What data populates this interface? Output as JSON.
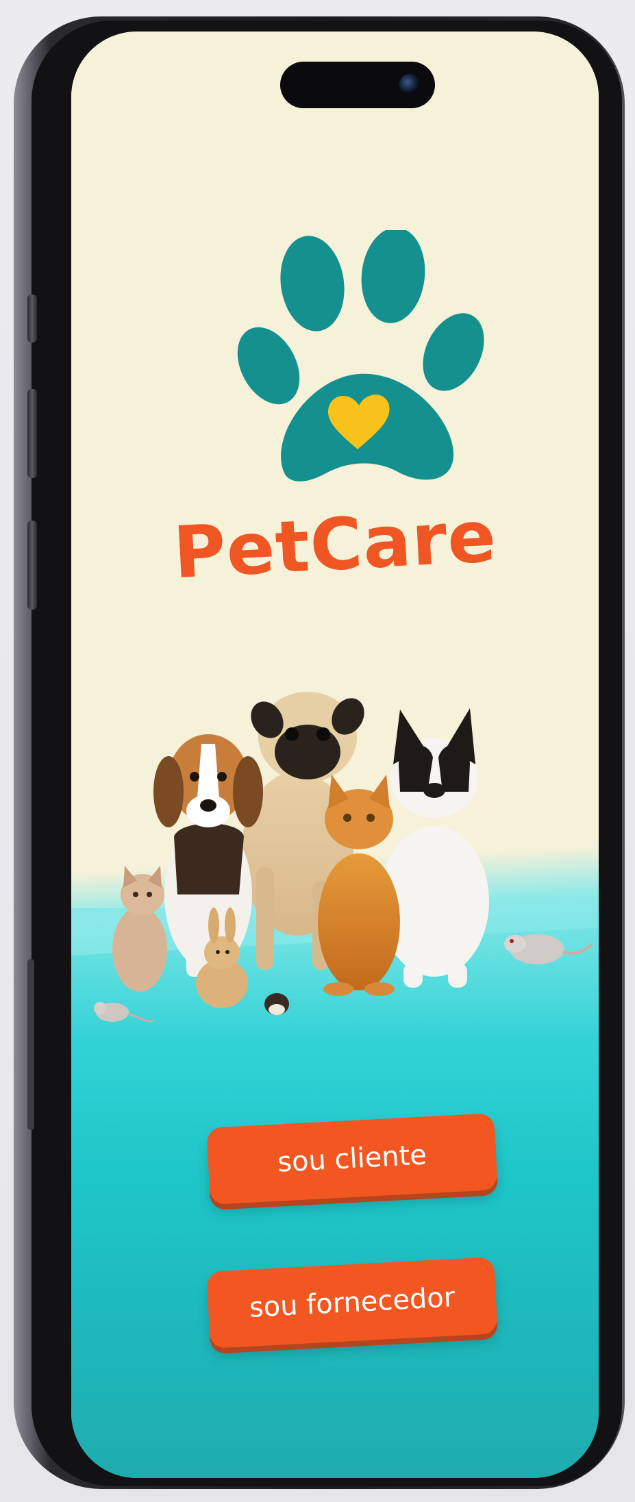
{
  "app": {
    "brand_name": "PetCare"
  },
  "actions": {
    "client_label": "sou cliente",
    "supplier_label": "sou fornecedor"
  },
  "colors": {
    "screen_background": "#f6f1d9",
    "floor_teal": "#1ec5c8",
    "paw_teal": "#14908f",
    "heart_yellow": "#f7c21a",
    "brand_orange": "#f05524",
    "button_orange": "#f25722"
  },
  "icons": {
    "logo": "paw-heart-icon"
  },
  "hero_image": {
    "description_name": "pets-group-illustration"
  }
}
